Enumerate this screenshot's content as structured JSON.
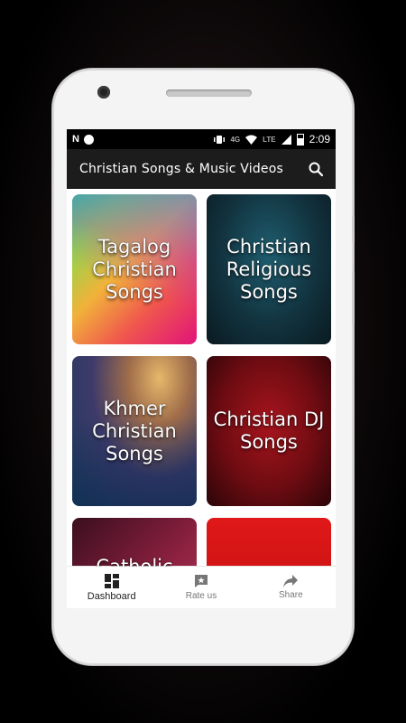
{
  "statusbar": {
    "notification_letter": "N",
    "network_type": "4G",
    "lte_label": "LTE",
    "time": "2:09"
  },
  "toolbar": {
    "title": "Christian Songs & Music Videos",
    "search_icon": "search-icon"
  },
  "categories": [
    {
      "label": "Tagalog Christian Songs"
    },
    {
      "label": "Christian Religious Songs"
    },
    {
      "label": "Khmer Christian Songs"
    },
    {
      "label": "Christian DJ Songs"
    },
    {
      "label": "Catholic"
    },
    {
      "label": ""
    }
  ],
  "bottom_nav": [
    {
      "label": "Dashboard",
      "icon": "dashboard-icon",
      "active": true
    },
    {
      "label": "Rate us",
      "icon": "rate-us-icon",
      "active": false
    },
    {
      "label": "Share",
      "icon": "share-icon",
      "active": false
    }
  ],
  "colors": {
    "toolbar_bg": "#1c1c1c",
    "statusbar_bg": "#000000",
    "card_red": "#a8141d"
  }
}
